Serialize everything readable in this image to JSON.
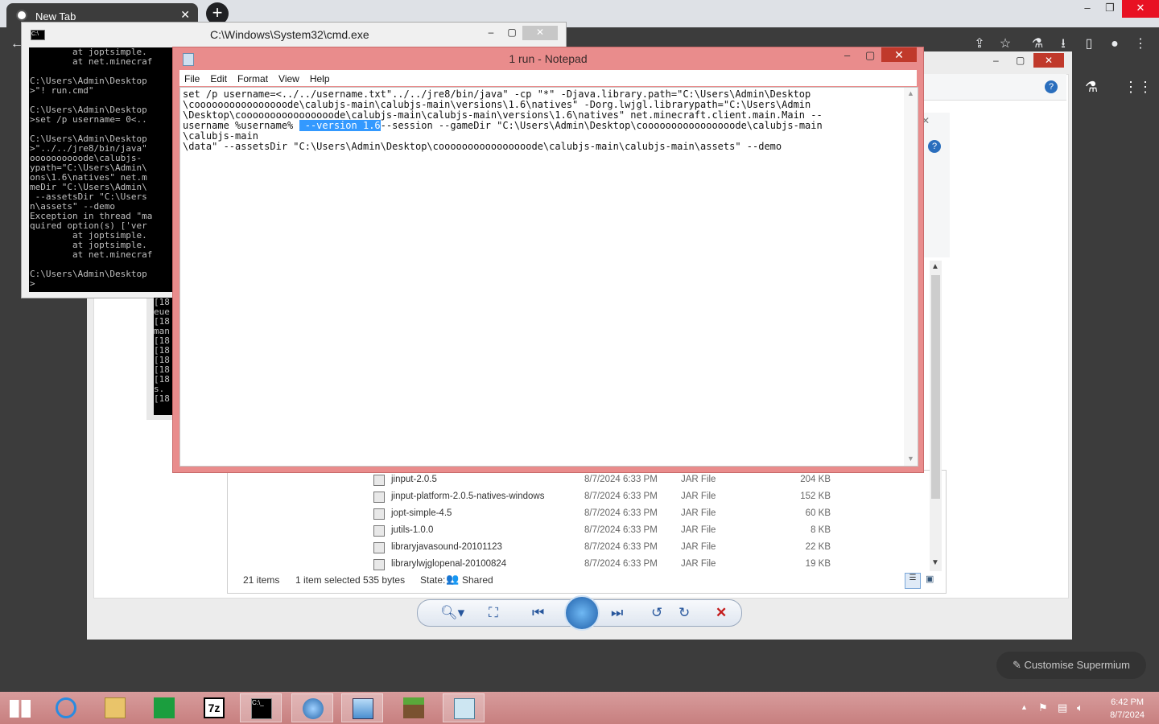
{
  "chrome": {
    "tab_title": "New Tab",
    "tab_close": "✕",
    "new_tab": "+",
    "min": "–",
    "restore": "❐",
    "close": "✕"
  },
  "explorer": {
    "files": [
      {
        "name": "jinput-2.0.5",
        "date": "8/7/2024 6:33 PM",
        "type": "JAR File",
        "size": "204 KB"
      },
      {
        "name": "jinput-platform-2.0.5-natives-windows",
        "date": "8/7/2024 6:33 PM",
        "type": "JAR File",
        "size": "152 KB"
      },
      {
        "name": "jopt-simple-4.5",
        "date": "8/7/2024 6:33 PM",
        "type": "JAR File",
        "size": "60 KB"
      },
      {
        "name": "jutils-1.0.0",
        "date": "8/7/2024 6:33 PM",
        "type": "JAR File",
        "size": "8 KB"
      },
      {
        "name": "libraryjavasound-20101123",
        "date": "8/7/2024 6:33 PM",
        "type": "JAR File",
        "size": "22 KB"
      },
      {
        "name": "librarylwjglopenal-20100824",
        "date": "8/7/2024 6:33 PM",
        "type": "JAR File",
        "size": "19 KB"
      }
    ],
    "status_items": "21 items",
    "status_selected": "1 item selected  535 bytes",
    "status_state_label": "State:",
    "status_state_value": "Shared"
  },
  "cmd": {
    "title": "C:\\Windows\\System32\\cmd.exe",
    "console": "        at joptsimple.\n        at net.minecraf\n\nC:\\Users\\Admin\\Desktop\n>\"! run.cmd\"\n\nC:\\Users\\Admin\\Desktop\n>set /p username= 0<..\n\nC:\\Users\\Admin\\Desktop\n>\"../../jre8/bin/java\"\noooooooooode\\calubjs-\nypath=\"C:\\Users\\Admin\\\nons\\1.6\\natives\" net.m\nmeDir \"C:\\Users\\Admin\\\n --assetsDir \"C:\\Users\nn\\assets\" --demo\nException in thread \"ma\nquired option(s) ['ver\n        at joptsimple.\n        at joptsimple.\n        at net.minecraf\n\nC:\\Users\\Admin\\Desktop\n>",
    "console2": "[18\neue\n[18\nman\n[18\n[18\n[18\n[18\n[18\ns.\n[18"
  },
  "notepad": {
    "title": "1 run - Notepad",
    "menu": [
      "File",
      "Edit",
      "Format",
      "View",
      "Help"
    ],
    "text_before": "set /p username=<../../username.txt\"../../jre8/bin/java\" -cp \"*\" -Djava.library.path=\"C:\\Users\\Admin\\Desktop\n\\coooooooooooooooode\\calubjs-main\\calubjs-main\\versions\\1.6\\natives\" -Dorg.lwjgl.librarypath=\"C:\\Users\\Admin\n\\Desktop\\coooooooooooooooode\\calubjs-main\\calubjs-main\\versions\\1.6\\natives\" net.minecraft.client.main.Main --\nusername %username% ",
    "text_selected": " --version 1.6",
    "text_after": "--session --gameDir \"C:\\Users\\Admin\\Desktop\\coooooooooooooooode\\calubjs-main\n\\calubjs-main\n\\data\" --assetsDir \"C:\\Users\\Admin\\Desktop\\coooooooooooooooode\\calubjs-main\\calubjs-main\\assets\" --demo"
  },
  "customise_label": "Customise Supermium",
  "clock": {
    "time": "6:42 PM",
    "date": "8/7/2024"
  }
}
